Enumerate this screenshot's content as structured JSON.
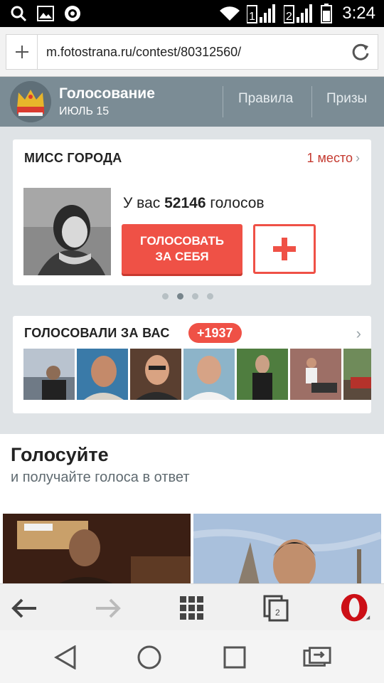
{
  "status_bar": {
    "time": "3:24",
    "sim1": "1",
    "sim2": "2"
  },
  "browser": {
    "url": "m.fotostrana.ru/contest/80312560/",
    "tabs_count": "2"
  },
  "header": {
    "title": "Голосование",
    "subtitle": "ИЮЛЬ 15",
    "nav": [
      "Правила",
      "Призы"
    ]
  },
  "contest_card": {
    "title": "МИСС ГОРОДА",
    "rank": "1 место",
    "votes_prefix": "У вас",
    "votes_count": "52146",
    "votes_suffix": "голосов",
    "vote_button_line1": "ГОЛОСОВАТЬ",
    "vote_button_line2": "ЗА СЕБЯ"
  },
  "carousel": {
    "pages": 4,
    "active": 1
  },
  "voters_card": {
    "title": "ГОЛОСОВАЛИ ЗА ВАС",
    "badge": "+1937",
    "thumbnails": 7
  },
  "vote_section": {
    "title": "Голосуйте",
    "subtitle": "и получайте голоса в ответ"
  },
  "colors": {
    "accent": "#ef5146",
    "header_bg": "#7b8c95",
    "page_bg": "#dfe3e6"
  },
  "icons": [
    "search-icon",
    "image-icon",
    "shield-icon",
    "wifi-icon",
    "signal-icon",
    "battery-icon",
    "plus-icon",
    "reload-icon",
    "back-arrow-icon",
    "forward-arrow-icon",
    "grid-icon",
    "tabs-icon",
    "opera-icon",
    "nav-back-icon",
    "nav-home-icon",
    "nav-recents-icon",
    "nav-switch-icon"
  ]
}
